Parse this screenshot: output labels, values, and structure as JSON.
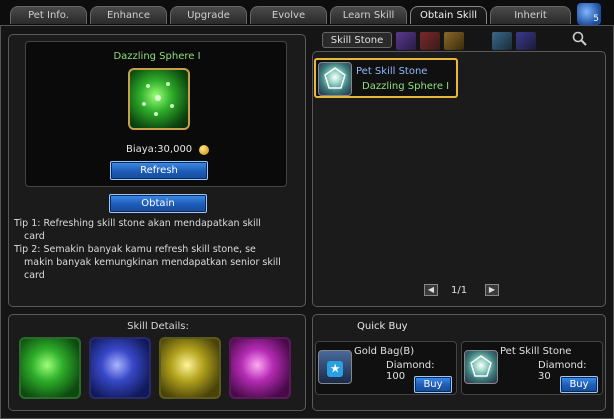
{
  "tabs": [
    {
      "label": "Pet Info."
    },
    {
      "label": "Enhance"
    },
    {
      "label": "Upgrade"
    },
    {
      "label": "Evolve"
    },
    {
      "label": "Learn Skill"
    },
    {
      "label": "Obtain Skill"
    },
    {
      "label": "Inherit"
    }
  ],
  "active_tab": "Obtain Skill",
  "tab_badge": "5",
  "left": {
    "stone_title": "Dazzling Sphere I",
    "cost_label": "Biaya:30,000",
    "refresh_label": "Refresh",
    "obtain_label": "Obtain",
    "tip1_line1": "Tip 1: Refreshing skill stone akan mendapatkan skill",
    "tip1_line2": "card",
    "tip2_line1": "Tip 2: Semakin banyak kamu refresh skill stone, se",
    "tip2_line2": "makin banyak kemungkinan mendapatkan senior skill",
    "tip2_line3": "card",
    "skill_details_label": "Skill Details:",
    "skill_stones": [
      {
        "color": "#2fae2a"
      },
      {
        "color": "#3848c8"
      },
      {
        "color": "#b3a31d"
      },
      {
        "color": "#b42bb4"
      }
    ]
  },
  "right": {
    "section_tab": "Skill Stone",
    "entry_name": "Pet Skill Stone",
    "entry_value": "Dazzling Sphere I",
    "page": "1/1"
  },
  "quick_buy": {
    "title": "Quick Buy",
    "items": [
      {
        "name": "Gold Bag(B)",
        "price": "Diamond: 100",
        "buy_label": "Buy"
      },
      {
        "name": "Pet Skill Stone",
        "price": "Diamond: 30",
        "buy_label": "Buy"
      }
    ]
  }
}
